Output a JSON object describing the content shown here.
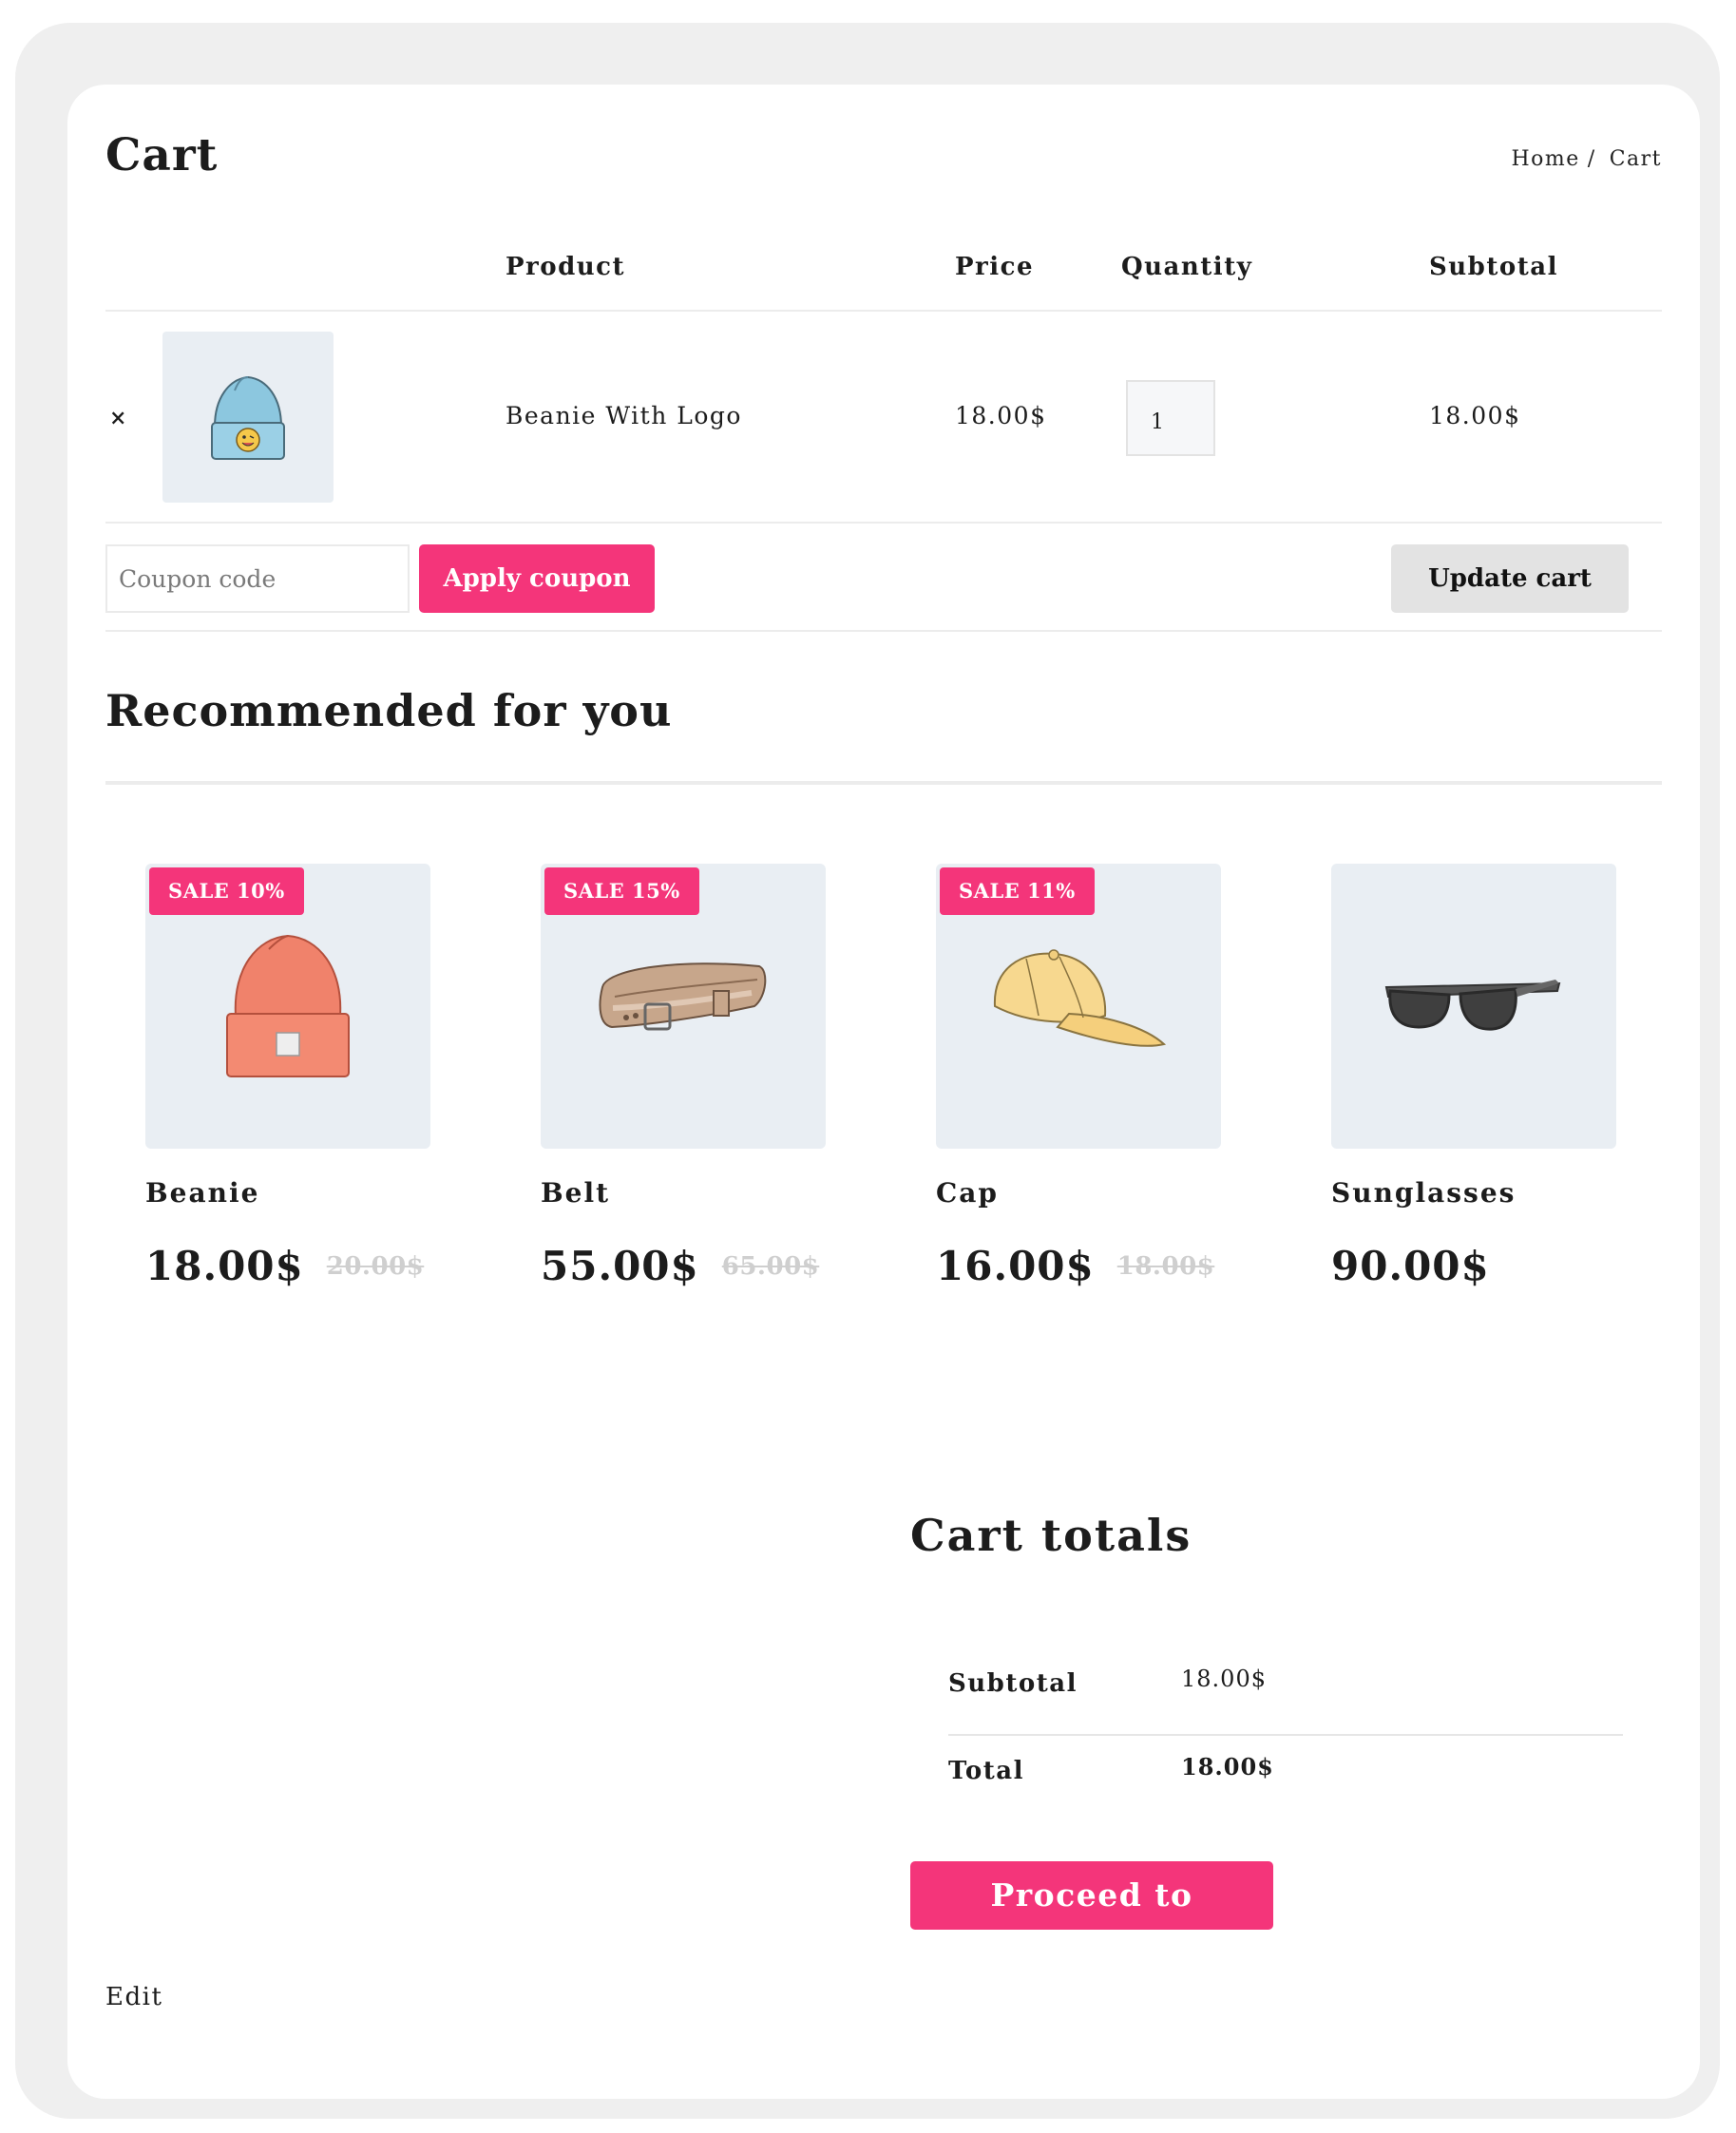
{
  "page": {
    "title": "Cart"
  },
  "breadcrumb": {
    "home": "Home",
    "separator": "/",
    "current": "Cart"
  },
  "cart_table": {
    "headers": {
      "product": "Product",
      "price": "Price",
      "quantity": "Quantity",
      "subtotal": "Subtotal"
    },
    "rows": [
      {
        "remove": "×",
        "name": "Beanie With Logo",
        "price": "18.00$",
        "quantity": "1",
        "subtotal": "18.00$",
        "image": "beanie-with-logo-image"
      }
    ]
  },
  "coupon": {
    "placeholder": "Coupon code",
    "apply_label": "Apply coupon"
  },
  "update_label": "Update cart",
  "recommended": {
    "title": "Recommended for you",
    "products": [
      {
        "badge": "SALE 10%",
        "name": "Beanie",
        "price": "18.00$",
        "old_price": "20.00$",
        "image": "beanie-image"
      },
      {
        "badge": "SALE 15%",
        "name": "Belt",
        "price": "55.00$",
        "old_price": "65.00$",
        "image": "belt-image"
      },
      {
        "badge": "SALE 11%",
        "name": "Cap",
        "price": "16.00$",
        "old_price": "18.00$",
        "image": "cap-image"
      },
      {
        "badge": "",
        "name": "Sunglasses",
        "price": "90.00$",
        "old_price": "",
        "image": "sunglasses-image"
      }
    ]
  },
  "totals": {
    "title": "Cart totals",
    "subtotal_label": "Subtotal",
    "subtotal_value": "18.00$",
    "total_label": "Total",
    "total_value": "18.00$",
    "checkout_label": "Proceed to checkout"
  },
  "edit_label": "Edit",
  "colors": {
    "accent": "#f4357a",
    "panel": "#e9eef3",
    "frame": "#efefef",
    "button_gray": "#e3e3e3"
  }
}
